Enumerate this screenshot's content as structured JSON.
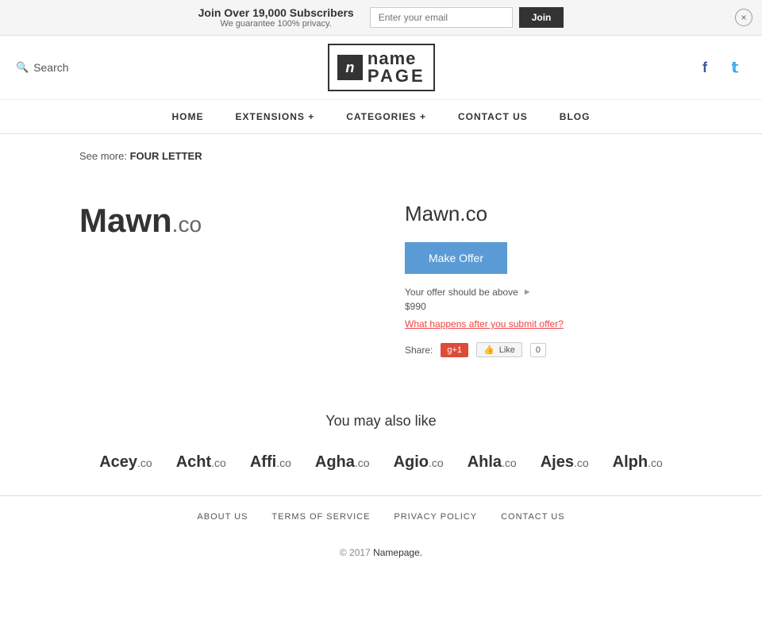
{
  "banner": {
    "title": "Join Over 19,000 Subscribers",
    "subtitle": "We guarantee 100% privacy.",
    "email_placeholder": "Enter your email",
    "join_label": "Join",
    "close_label": "×"
  },
  "header": {
    "search_label": "Search",
    "logo_icon": "n",
    "logo_name": "name",
    "logo_page": "PAGE",
    "social": {
      "facebook": "f",
      "twitter": "t"
    }
  },
  "nav": {
    "items": [
      {
        "label": "HOME",
        "id": "home"
      },
      {
        "label": "EXTENSIONS +",
        "id": "extensions"
      },
      {
        "label": "CATEGORIES +",
        "id": "categories"
      },
      {
        "label": "CONTACT US",
        "id": "contact"
      },
      {
        "label": "BLOG",
        "id": "blog"
      }
    ]
  },
  "see_more": {
    "prefix": "See more:",
    "link_label": "FOUR LETTER"
  },
  "domain": {
    "name_display": "Mawn",
    "ext_display": ".co",
    "full_name": "Mawn.co",
    "make_offer_label": "Make Offer",
    "offer_hint": "Your offer should be above",
    "offer_price": "$990",
    "what_happens_label": "What happens after you submit offer?",
    "share_label": "Share:",
    "gplus_label": "g+1",
    "fb_like_label": "Like",
    "fb_count": "0"
  },
  "also_like": {
    "title": "You may also like",
    "items": [
      {
        "name": "Acey",
        "ext": ".co"
      },
      {
        "name": "Acht",
        "ext": ".co"
      },
      {
        "name": "Affi",
        "ext": ".co"
      },
      {
        "name": "Agha",
        "ext": ".co"
      },
      {
        "name": "Agio",
        "ext": ".co"
      },
      {
        "name": "Ahla",
        "ext": ".co"
      },
      {
        "name": "Ajes",
        "ext": ".co"
      },
      {
        "name": "Alph",
        "ext": ".co"
      }
    ]
  },
  "footer": {
    "links": [
      {
        "label": "ABOUT US",
        "id": "about"
      },
      {
        "label": "TERMS OF SERVICE",
        "id": "terms"
      },
      {
        "label": "PRIVACY POLICY",
        "id": "privacy"
      },
      {
        "label": "CONTACT US",
        "id": "contact"
      }
    ],
    "copyright": "© 2017",
    "copyright_link": "Namepage."
  }
}
